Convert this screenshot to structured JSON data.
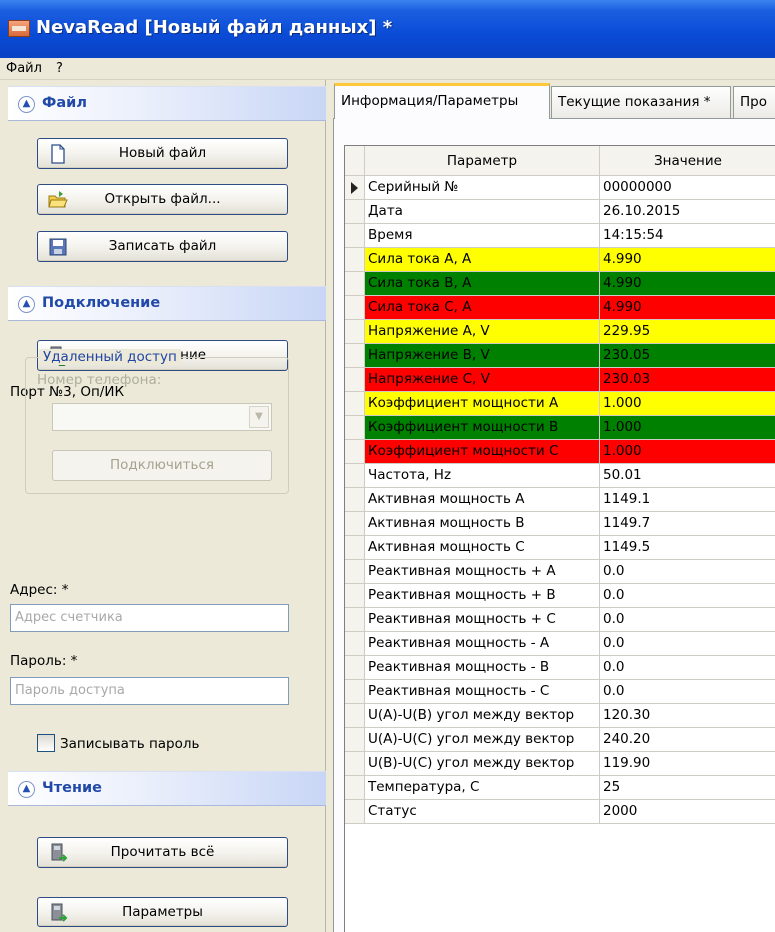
{
  "window": {
    "title": "NevaRead [Новый файл данных] *"
  },
  "menu": [
    "Файл",
    "?"
  ],
  "sections": {
    "file": "Файл",
    "connection": "Подключение",
    "reading": "Чтение"
  },
  "file_buttons": {
    "new": "Новый файл",
    "open": "Открыть файл...",
    "save": "Записать файл"
  },
  "connection": {
    "connect_button": "Соединение",
    "port_status": "Порт №3, Оп/ИК",
    "remote_group": "Удаленный доступ",
    "phone_label": "Номер телефона:",
    "phone_value": "",
    "connect_remote_button": "Подключиться",
    "address_label": "Адрес: *",
    "address_placeholder": "Адрес счетчика",
    "password_label": "Пароль: *",
    "password_placeholder": "Пароль доступа",
    "save_password_label": "Записывать пароль"
  },
  "reading": {
    "read_all_button": "Прочитать всё",
    "params_button": "Параметры"
  },
  "tabs": [
    "Информация/Параметры",
    "Текущие показания *",
    "Про"
  ],
  "grid": {
    "headers": [
      "Параметр",
      "Значение"
    ],
    "rows": [
      {
        "param": "Серийный №",
        "value": "00000000",
        "color": "white"
      },
      {
        "param": "Дата",
        "value": "26.10.2015",
        "color": "white"
      },
      {
        "param": "Время",
        "value": "14:15:54",
        "color": "white"
      },
      {
        "param": "Сила тока А, А",
        "value": "4.990",
        "color": "yellow"
      },
      {
        "param": "Сила тока В, А",
        "value": "4.990",
        "color": "green"
      },
      {
        "param": "Сила тока С, А",
        "value": "4.990",
        "color": "red"
      },
      {
        "param": "Напряжение А, V",
        "value": "229.95",
        "color": "yellow"
      },
      {
        "param": "Напряжение В, V",
        "value": "230.05",
        "color": "green"
      },
      {
        "param": "Напряжение С, V",
        "value": "230.03",
        "color": "red"
      },
      {
        "param": "Коэффициент мощности А",
        "value": "1.000",
        "color": "yellow"
      },
      {
        "param": "Коэффициент мощности В",
        "value": "1.000",
        "color": "green"
      },
      {
        "param": "Коэффициент мощности С",
        "value": "1.000",
        "color": "red"
      },
      {
        "param": "Частота, Hz",
        "value": "50.01",
        "color": "white"
      },
      {
        "param": "Активная мощность А",
        "value": "1149.1",
        "color": "white"
      },
      {
        "param": "Активная мощность В",
        "value": "1149.7",
        "color": "white"
      },
      {
        "param": "Активная мощность С",
        "value": "1149.5",
        "color": "white"
      },
      {
        "param": "Реактивная мощность + А",
        "value": "0.0",
        "color": "white"
      },
      {
        "param": "Реактивная мощность + В",
        "value": "0.0",
        "color": "white"
      },
      {
        "param": "Реактивная мощность + С",
        "value": "0.0",
        "color": "white"
      },
      {
        "param": "Реактивная мощность - А",
        "value": "0.0",
        "color": "white"
      },
      {
        "param": "Реактивная мощность - В",
        "value": "0.0",
        "color": "white"
      },
      {
        "param": "Реактивная мощность - С",
        "value": "0.0",
        "color": "white"
      },
      {
        "param": "U(A)-U(B) угол между вектор",
        "value": "120.30",
        "color": "white"
      },
      {
        "param": "U(A)-U(C) угол между вектор",
        "value": "240.20",
        "color": "white"
      },
      {
        "param": "U(B)-U(C) угол между вектор",
        "value": "119.90",
        "color": "white"
      },
      {
        "param": "Температура, С",
        "value": "25",
        "color": "white"
      },
      {
        "param": "Статус",
        "value": "2000",
        "color": "white"
      }
    ]
  },
  "colors": {
    "yellow": "#ffff00",
    "green": "#008000",
    "red": "#ff0000",
    "white": "#ffffff",
    "title_bar": "#0a4bd6",
    "section_text": "#214aa8"
  }
}
